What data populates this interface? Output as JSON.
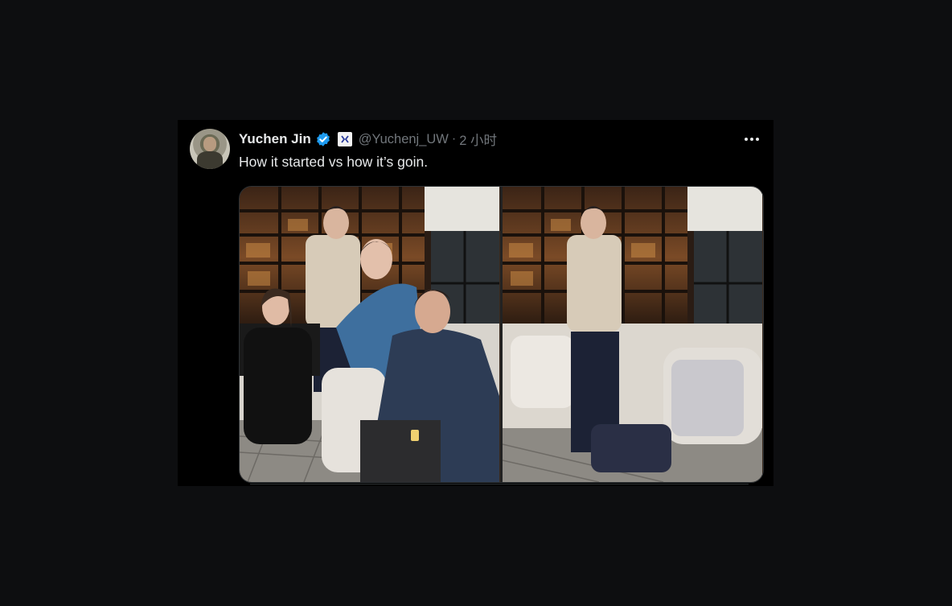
{
  "tweet": {
    "author_name": "Yuchen Jin",
    "handle": "@Yuchenj_UW",
    "separator": "·",
    "time": "2 小时",
    "text": "How it started vs how it’s goin.",
    "more_icon": "more-horizontal-icon",
    "verified_icon": "verified-badge-icon",
    "verified_color": "#1d9bf0",
    "affiliation_icon": "affiliation-badge-icon",
    "media": {
      "images": [
        {
          "description_name": "photo-left"
        },
        {
          "description_name": "photo-right"
        }
      ]
    }
  },
  "colors": {
    "background": "#0d0e10",
    "tweet_bg": "#000000",
    "text_primary": "#e7e9ea",
    "text_secondary": "#71767b"
  }
}
